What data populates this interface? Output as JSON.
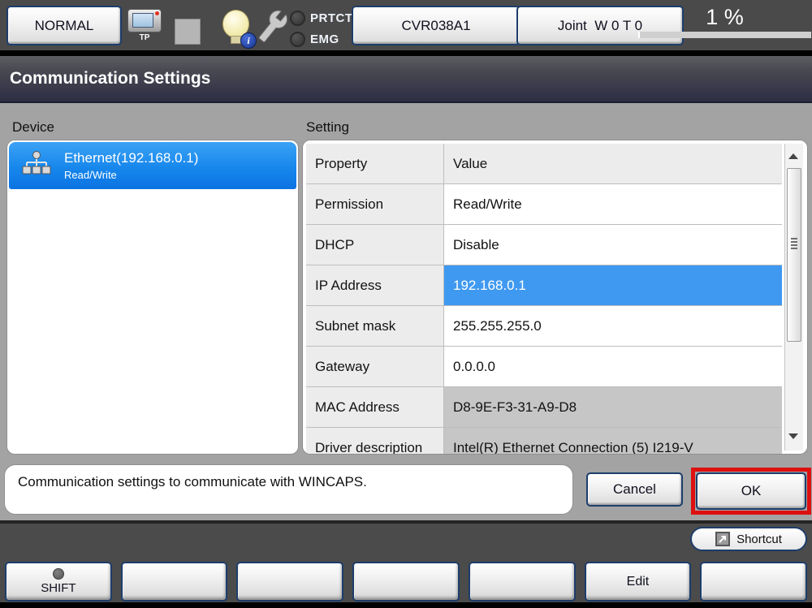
{
  "topbar": {
    "mode_button_label": "NORMAL",
    "tp_icon_label": "TP",
    "prtct_label": "PRTCT",
    "emg_label": "EMG",
    "robot_name_button": "CVR038A1",
    "coordinate_button": "Joint  W 0 T 0",
    "speed_display": "1 %",
    "speed_percent": 1
  },
  "title_bar": {
    "title": "Communication Settings"
  },
  "device_section": {
    "label": "Device",
    "items": [
      {
        "name": "Ethernet(192.168.0.1)",
        "permission": "Read/Write",
        "selected": true
      }
    ]
  },
  "setting_section": {
    "label": "Setting",
    "columns": {
      "property": "Property",
      "value": "Value"
    },
    "rows": [
      {
        "property": "Permission",
        "value": "Read/Write",
        "state": "normal"
      },
      {
        "property": "DHCP",
        "value": "Disable",
        "state": "normal"
      },
      {
        "property": "IP Address",
        "value": "192.168.0.1",
        "state": "selected"
      },
      {
        "property": "Subnet mask",
        "value": "255.255.255.0",
        "state": "normal"
      },
      {
        "property": "Gateway",
        "value": "0.0.0.0",
        "state": "normal"
      },
      {
        "property": "MAC Address",
        "value": "D8-9E-F3-31-A9-D8",
        "state": "readonly"
      },
      {
        "property": "Driver description",
        "value": "Intel(R) Ethernet Connection (5) I219-V",
        "state": "readonly"
      }
    ]
  },
  "status_message": "Communication settings to communicate with WINCAPS.",
  "dialog_buttons": {
    "cancel": "Cancel",
    "ok": "OK"
  },
  "shortcut_button": {
    "label": "Shortcut"
  },
  "function_keys": [
    {
      "label": "SHIFT",
      "has_led": true
    },
    {
      "label": ""
    },
    {
      "label": ""
    },
    {
      "label": ""
    },
    {
      "label": ""
    },
    {
      "label": "Edit"
    },
    {
      "label": ""
    }
  ],
  "colors": {
    "selection_blue": "#1787ec",
    "selected_cell_blue": "#3f99f0",
    "highlight_red": "#dd1010",
    "navy_border": "#1d3d6b",
    "readonly_gray": "#c6c6c6"
  }
}
